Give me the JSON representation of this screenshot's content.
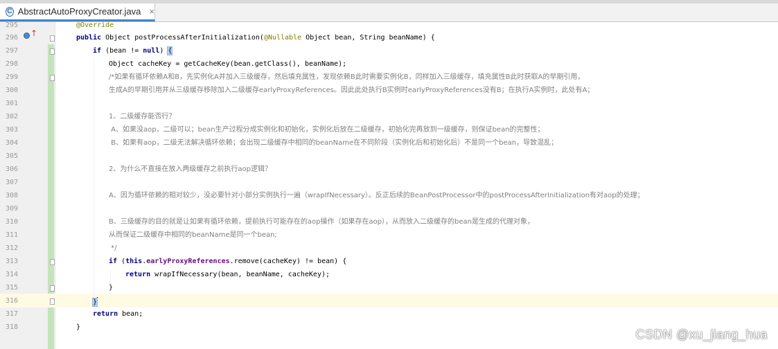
{
  "tab": {
    "icon": "class-icon",
    "icon_letter": "C",
    "title": "AbstractAutoProxyCreator.java",
    "close": "×"
  },
  "gutter": {
    "override_icon": "override-up-arrow-icon",
    "line_numbers": [
      "295",
      "296",
      "297",
      "298",
      "299",
      "300",
      "301",
      "302",
      "303",
      "304",
      "305",
      "306",
      "307",
      "308",
      "309",
      "310",
      "311",
      "312",
      "313",
      "314",
      "315",
      "316",
      "317",
      "318"
    ]
  },
  "code": {
    "l295": "@Override",
    "l296_kw": "public",
    "l296_a": " Object postProcessAfterInitialization(",
    "l296_ann": "@Nullable",
    "l296_b": " Object bean, String beanName) {",
    "l297_if": "if",
    "l297_a": " (bean != ",
    "l297_null": "null",
    "l297_b": ") ",
    "l297_brace": "{",
    "l298": "Object cacheKey = getCacheKey(bean.getClass(), beanName);",
    "l299": "/*如果有循环依赖A和B，先实例化A并加入三级缓存，然后填充属性，发现依赖B此时需要实例化B，同样加入三级缓存，填充属性B此时获取A的早期引用，",
    "l300": "生成A的早期引用并从三级缓存移除加入二级缓存earlyProxyReferences。因此此处执行B实例时earlyProxyReferences没有B；在执行A实例时，此处有A；",
    "l302": "1、二级缓存能否行？",
    "l303": " A、如果没aop，二级可以；bean生产过程分成实例化和初始化，实例化后放在二级缓存，初始化完再放到一级缓存，则保证bean的完整性；",
    "l304": " B、如果有aop，二级无法解决循环依赖；会出现二级缓存中相同的beanName在不同阶段（实例化后和初始化后）不是同一个bean，导致混乱；",
    "l306": "2、为什么不直接在放入两级缓存之前执行aop逻辑？",
    "l308": "A、因为循环依赖的相对较少，没必要针对小部分实例执行一遍（wrapIfNecessary）。反正后续的BeanPostProcessor中的postProcessAfterInitialization有对aop的处理；",
    "l310": "B、三级缓存的目的就是让如果有循环依赖，提前执行可能存在的aop操作（如果存在aop），从而放入二级缓存的bean是生成的代理对象，",
    "l311": "从而保证二级缓存中相同的beanName是同一个bean;",
    "l312": " */",
    "l313_if": "if",
    "l313_a": " (",
    "l313_this": "this",
    "l313_dot": ".",
    "l313_field": "earlyProxyReferences",
    "l313_b": ".remove(cacheKey) != bean) {",
    "l314_ret": "return",
    "l314_a": " wrapIfNecessary(bean, beanName, cacheKey);",
    "l315": "}",
    "l316": "}",
    "l317_ret": "return",
    "l317_a": " bean;",
    "l318": "}"
  },
  "watermark": "CSDN @xu_jiang_hua"
}
